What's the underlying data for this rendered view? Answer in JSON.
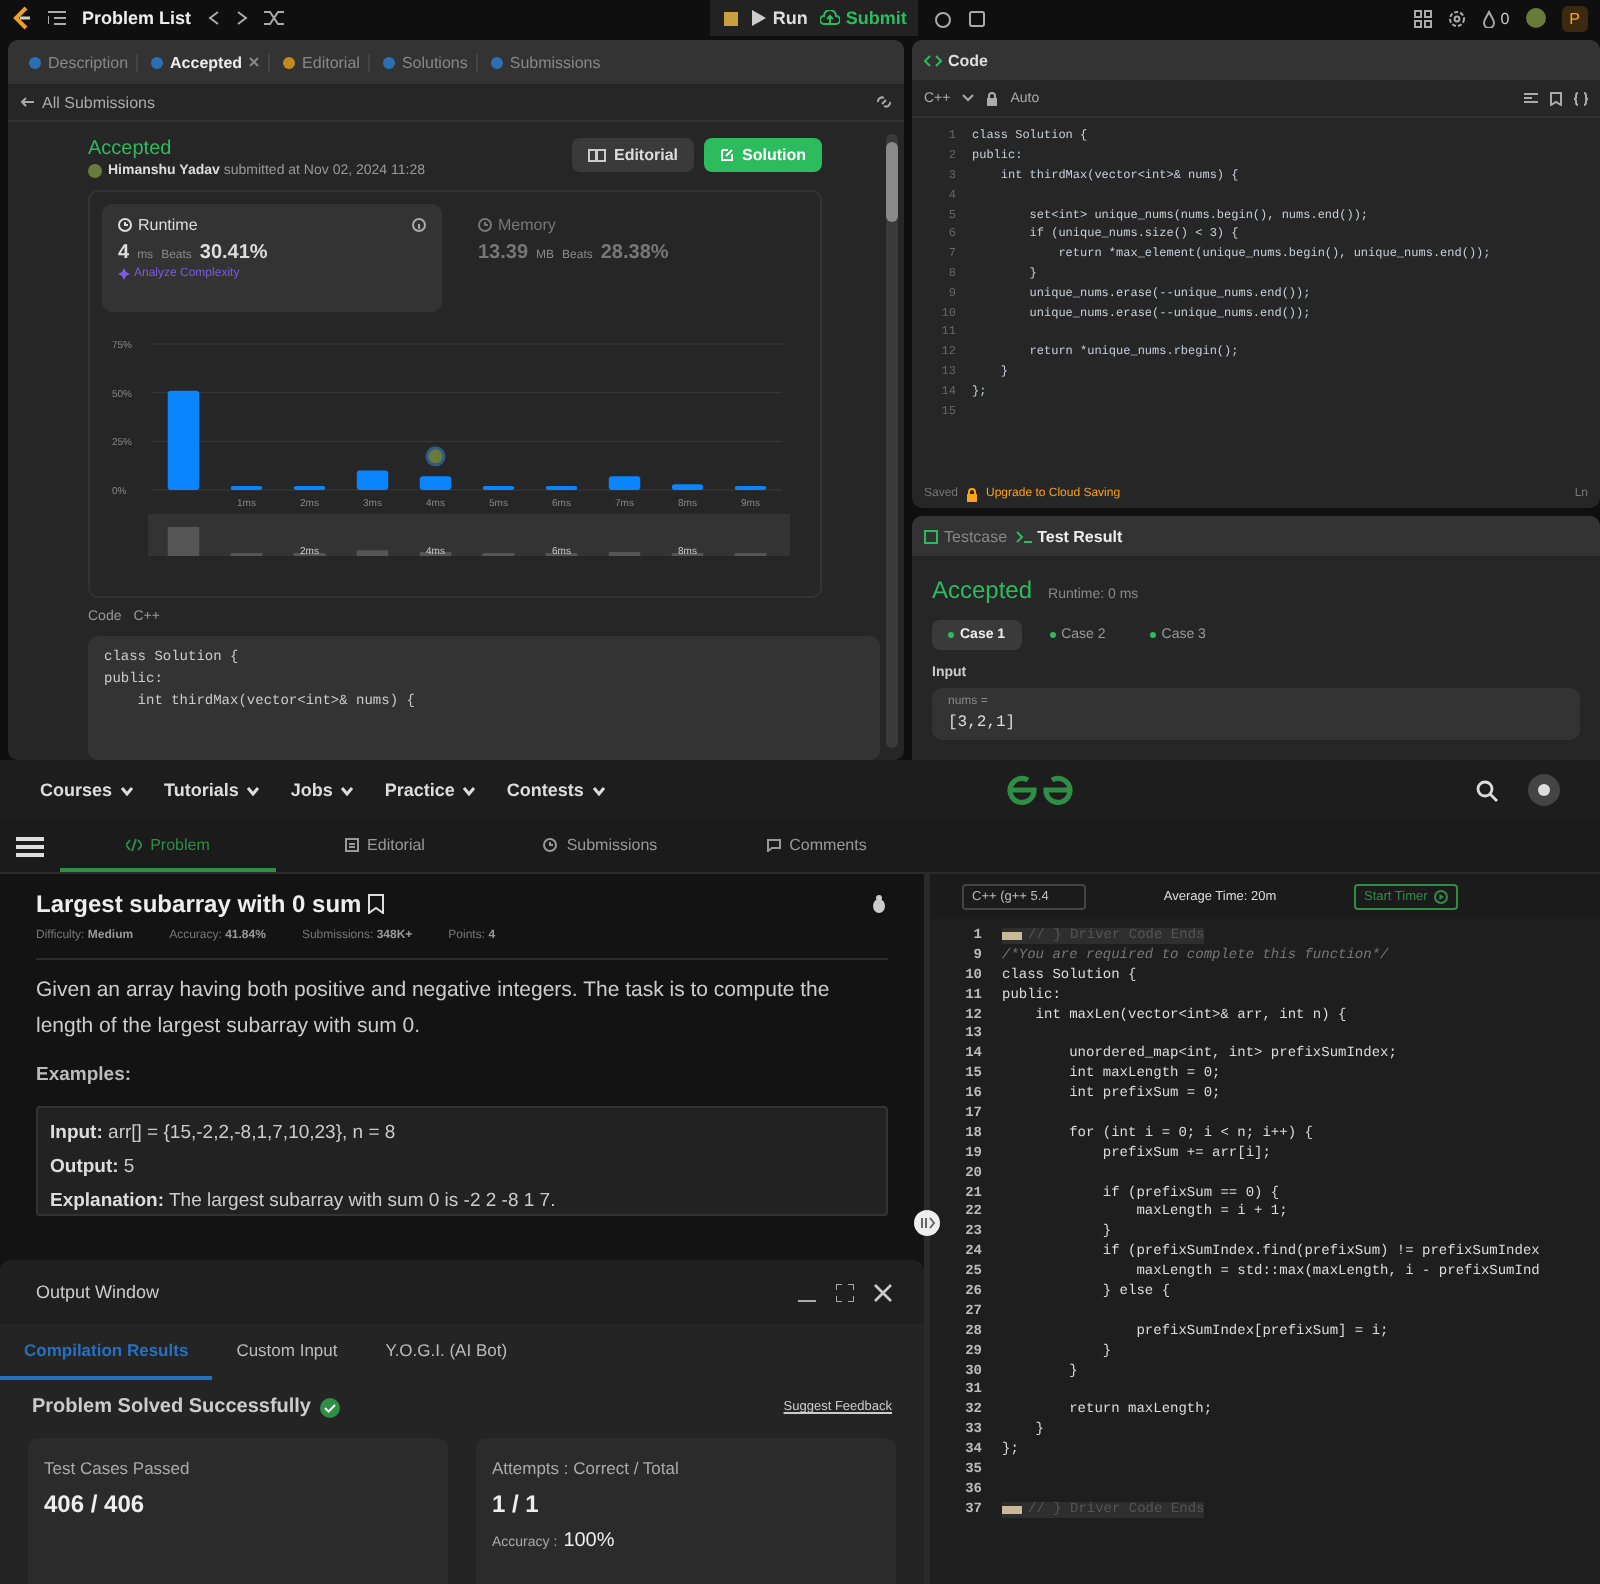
{
  "leetcode": {
    "top_bar": {
      "title": "Problem List",
      "run": "Run",
      "submit": "Submit",
      "streak": "0",
      "premium": "P"
    },
    "left_tabs": [
      {
        "label": "Description",
        "selected": false,
        "closable": false
      },
      {
        "label": "Accepted",
        "selected": true,
        "closable": true
      },
      {
        "label": "Editorial",
        "selected": false,
        "closable": false
      },
      {
        "label": "Solutions",
        "selected": false,
        "closable": false
      },
      {
        "label": "Submissions",
        "selected": false,
        "closable": false
      }
    ],
    "back_link": "All Submissions",
    "submission": {
      "status": "Accepted",
      "user": "Himanshu Yadav",
      "submitted": "submitted at Nov 02, 2024 11:28",
      "editorial_button": "Editorial",
      "solution_button": "Solution"
    },
    "stats": [
      {
        "label": "Runtime",
        "value": "4",
        "unit": "ms",
        "beats_label": "Beats",
        "beats": "30.41%",
        "analyze": "Analyze Complexity",
        "selected": true
      },
      {
        "label": "Memory",
        "value": "13.39",
        "unit": "MB",
        "beats_label": "Beats",
        "beats": "28.38%",
        "selected": false
      }
    ],
    "chart_data": {
      "type": "bar",
      "categories": [
        null,
        "1ms",
        "2ms",
        "3ms",
        "4ms",
        "5ms",
        "6ms",
        "7ms",
        "8ms",
        "9ms"
      ],
      "values": [
        51,
        2,
        2,
        10,
        7,
        2,
        2,
        7,
        3,
        2
      ],
      "ylim": [
        0,
        75
      ],
      "yticks": [
        {
          "value": 0,
          "label": "0%"
        },
        {
          "value": 25,
          "label": "25%"
        },
        {
          "value": 50,
          "label": "50%"
        },
        {
          "value": 75,
          "label": "75%"
        }
      ],
      "annotations": [
        {
          "x": "4ms"
        }
      ]
    },
    "navigator_labels": [
      "2ms",
      "4ms",
      "6ms",
      "8ms"
    ],
    "code_section": {
      "label": "Code",
      "language": "C++",
      "lines": [
        "class Solution {",
        "public:",
        "    int thirdMax(vector<int>& nums) {"
      ]
    },
    "editor": {
      "title": "Code",
      "language": "C++",
      "mode": "Auto",
      "lines": [
        {
          "n": "1",
          "text": "class Solution {"
        },
        {
          "n": "2",
          "text": "public:"
        },
        {
          "n": "3",
          "text": "    int thirdMax(vector<int>& nums) {"
        },
        {
          "n": "4"
        },
        {
          "n": "5",
          "text": "        set<int> unique_nums(nums.begin(), nums.end());"
        },
        {
          "n": "6",
          "text": "        if (unique_nums.size() < 3) {"
        },
        {
          "n": "7",
          "text": "            return *max_element(unique_nums.begin(), unique_nums.end());"
        },
        {
          "n": "8",
          "text": "        }"
        },
        {
          "n": "9",
          "text": "        unique_nums.erase(--unique_nums.end());"
        },
        {
          "n": "10",
          "text": "        unique_nums.erase(--unique_nums.end());"
        },
        {
          "n": "11"
        },
        {
          "n": "12",
          "text": "        return *unique_nums.rbegin();"
        },
        {
          "n": "13",
          "text": "    }"
        },
        {
          "n": "14",
          "text": "};"
        },
        {
          "n": "15"
        }
      ],
      "saved": "Saved",
      "upgrade": "Upgrade to Cloud Saving",
      "cursor": "Ln"
    },
    "result_tabs": [
      {
        "label": "Testcase",
        "selected": false
      },
      {
        "label": "Test Result",
        "selected": true
      }
    ],
    "result": {
      "status": "Accepted",
      "runtime": "Runtime: 0 ms",
      "cases": [
        {
          "label": "Case 1",
          "selected": true
        },
        {
          "label": "Case 2",
          "selected": false
        },
        {
          "label": "Case 3",
          "selected": false
        }
      ],
      "input_label": "Input",
      "variable": "nums =",
      "value": "[3,2,1]"
    }
  },
  "gfg": {
    "nav": [
      "Courses",
      "Tutorials",
      "Jobs",
      "Practice",
      "Contests"
    ],
    "tabs": [
      {
        "label": "Problem",
        "selected": true
      },
      {
        "label": "Editorial",
        "selected": false
      },
      {
        "label": "Submissions",
        "selected": false
      },
      {
        "label": "Comments",
        "selected": false
      }
    ],
    "problem": {
      "title": "Largest subarray with 0 sum",
      "meta": [
        {
          "label": "Difficulty:",
          "value": "Medium"
        },
        {
          "label": "Accuracy:",
          "value": "41.84%"
        },
        {
          "label": "Submissions:",
          "value": "348K+"
        },
        {
          "label": "Points:",
          "value": "4"
        }
      ],
      "description": "Given an array having both positive and negative integers. The task is to compute the length of the largest subarray with sum 0.",
      "examples_heading": "Examples:",
      "example": [
        "**Input:** arr[] = {15,-2,2,-8,1,7,10,23}, n = 8",
        "**Output:** 5",
        "**Explanation:** The largest subarray with sum 0 is -2 2 -8 1 7."
      ]
    },
    "output_window": {
      "title": "Output Window",
      "tabs": [
        {
          "label": "Compilation Results",
          "selected": true
        },
        {
          "label": "Custom Input",
          "selected": false
        },
        {
          "label": "Y.O.G.I. (AI Bot)",
          "selected": false
        }
      ],
      "message": "Problem Solved Successfully",
      "feedback": "Suggest Feedback",
      "cards": [
        {
          "label": "Test Cases Passed",
          "value": "406 / 406"
        },
        {
          "label": "Attempts : Correct / Total",
          "value": "1 / 1",
          "extra_label": "Accuracy :",
          "extra_value": "100%"
        }
      ]
    },
    "editor": {
      "language": "C++ (g++ 5.4",
      "average_time": "Average Time: 20m",
      "timer": "Start Timer",
      "lines": [
        {
          "n": "1",
          "kind": "folded",
          "text": "// } Driver Code Ends"
        },
        {
          "n": "9",
          "kind": "comment",
          "text": "/*You are required to complete this function*/"
        },
        {
          "n": "10",
          "kind": "code",
          "text": "class Solution {"
        },
        {
          "n": "11",
          "kind": "code",
          "text": "public:"
        },
        {
          "n": "12",
          "kind": "code",
          "text": "    int maxLen(vector<int>& arr, int n) {"
        },
        {
          "n": "13",
          "kind": "blank"
        },
        {
          "n": "14",
          "kind": "code",
          "text": "        unordered_map<int, int> prefixSumIndex;"
        },
        {
          "n": "15",
          "kind": "code",
          "text": "        int maxLength = 0;"
        },
        {
          "n": "16",
          "kind": "code",
          "text": "        int prefixSum = 0;"
        },
        {
          "n": "17",
          "kind": "blank"
        },
        {
          "n": "18",
          "kind": "code",
          "text": "        for (int i = 0; i < n; i++) {"
        },
        {
          "n": "19",
          "kind": "code",
          "text": "            prefixSum += arr[i];"
        },
        {
          "n": "20",
          "kind": "blank"
        },
        {
          "n": "21",
          "kind": "code",
          "text": "            if (prefixSum == 0) {"
        },
        {
          "n": "22",
          "kind": "code",
          "text": "                maxLength = i + 1;"
        },
        {
          "n": "23",
          "kind": "code",
          "text": "            }"
        },
        {
          "n": "24",
          "kind": "code",
          "text": "            if (prefixSumIndex.find(prefixSum) != prefixSumIndex"
        },
        {
          "n": "25",
          "kind": "code",
          "text": "                maxLength = std::max(maxLength, i - prefixSumInd"
        },
        {
          "n": "26",
          "kind": "code",
          "text": "            } else {"
        },
        {
          "n": "27",
          "kind": "blank"
        },
        {
          "n": "28",
          "kind": "code",
          "text": "                prefixSumIndex[prefixSum] = i;"
        },
        {
          "n": "29",
          "kind": "code",
          "text": "            }"
        },
        {
          "n": "30",
          "kind": "code",
          "text": "        }"
        },
        {
          "n": "31",
          "kind": "blank"
        },
        {
          "n": "32",
          "kind": "code",
          "text": "        return maxLength;"
        },
        {
          "n": "33",
          "kind": "code",
          "text": "    }"
        },
        {
          "n": "34",
          "kind": "code",
          "text": "};"
        },
        {
          "n": "35",
          "kind": "blank"
        },
        {
          "n": "36",
          "kind": "blank"
        },
        {
          "n": "37",
          "kind": "folded",
          "text": "// } Driver Code Ends"
        }
      ]
    }
  }
}
